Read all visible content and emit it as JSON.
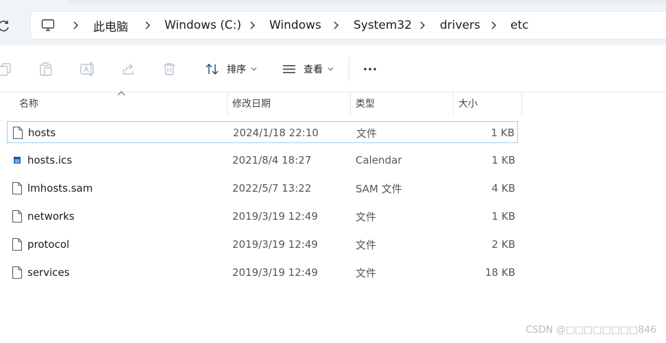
{
  "breadcrumb": {
    "items": [
      {
        "label": "此电脑"
      },
      {
        "label": "Windows (C:)"
      },
      {
        "label": "Windows"
      },
      {
        "label": "System32"
      },
      {
        "label": "drivers"
      },
      {
        "label": "etc"
      }
    ]
  },
  "toolbar": {
    "copy_icon": "copy-icon",
    "paste_icon": "paste-icon",
    "rename_icon": "rename-icon",
    "share_icon": "share-icon",
    "delete_icon": "delete-icon",
    "sort_label": "排序",
    "view_label": "查看",
    "more_label": "···"
  },
  "columns": {
    "name": "名称",
    "modified": "修改日期",
    "type": "类型",
    "size": "大小"
  },
  "files": [
    {
      "name": "hosts",
      "modified": "2024/1/18 22:10",
      "type": "文件",
      "size": "1 KB",
      "icon": "file-icon",
      "selected": true
    },
    {
      "name": "hosts.ics",
      "modified": "2021/8/4 18:27",
      "type": "Calendar",
      "size": "1 KB",
      "icon": "calendar-file-icon",
      "selected": false
    },
    {
      "name": "lmhosts.sam",
      "modified": "2022/5/7 13:22",
      "type": "SAM 文件",
      "size": "4 KB",
      "icon": "file-icon",
      "selected": false
    },
    {
      "name": "networks",
      "modified": "2019/3/19 12:49",
      "type": "文件",
      "size": "1 KB",
      "icon": "file-icon",
      "selected": false
    },
    {
      "name": "protocol",
      "modified": "2019/3/19 12:49",
      "type": "文件",
      "size": "2 KB",
      "icon": "file-icon",
      "selected": false
    },
    {
      "name": "services",
      "modified": "2019/3/19 12:49",
      "type": "文件",
      "size": "18 KB",
      "icon": "file-icon",
      "selected": false
    }
  ],
  "watermark": "CSDN @□□□□□□□□846",
  "colors": {
    "address_bg": "#eff4f9",
    "selection_border": "#99cde8",
    "icon_disabled": "#b8c4cf"
  }
}
